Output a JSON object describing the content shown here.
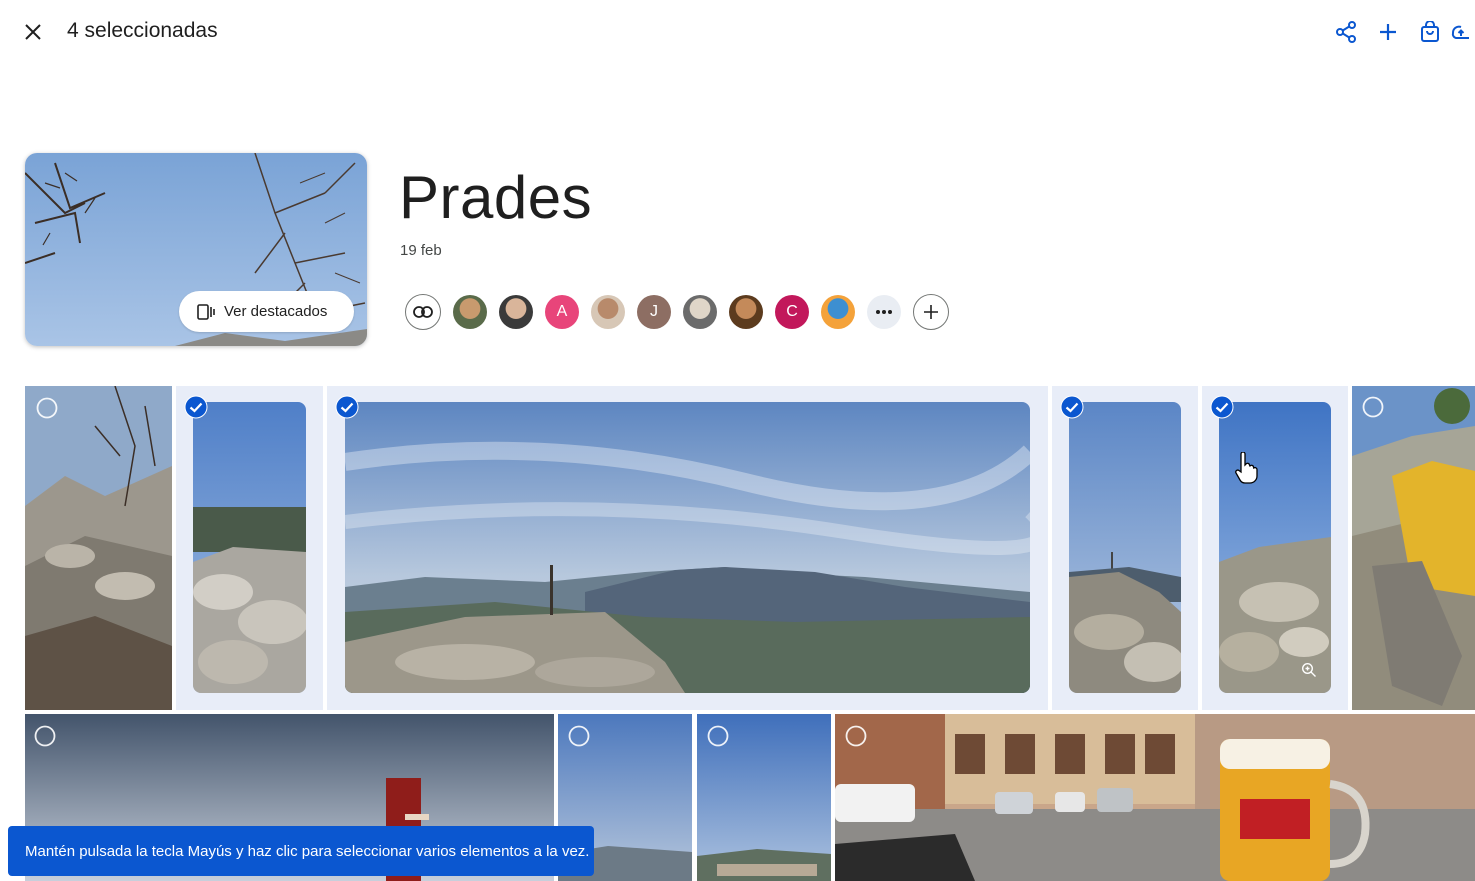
{
  "header": {
    "selection_count": "4 seleccionadas",
    "actions": [
      "share-icon",
      "add-icon",
      "bag-icon",
      "cloud-upload-icon"
    ]
  },
  "album": {
    "title": "Prades",
    "date": "19 feb",
    "highlights_label": "Ver destacados"
  },
  "people": {
    "avatars": [
      {
        "type": "photo",
        "colors": [
          "#5a6b4a",
          "#c89a6e"
        ]
      },
      {
        "type": "photo",
        "colors": [
          "#3a3a3a",
          "#d9b59a"
        ]
      },
      {
        "type": "letter",
        "letter": "A",
        "color": "#e8457a"
      },
      {
        "type": "photo",
        "colors": [
          "#d7c7b6",
          "#b88a6b"
        ]
      },
      {
        "type": "letter",
        "letter": "J",
        "color": "#8d6e63"
      },
      {
        "type": "photo",
        "colors": [
          "#6b6b6b",
          "#e0d6c8"
        ]
      },
      {
        "type": "photo",
        "colors": [
          "#5c3b1e",
          "#c48a5a"
        ]
      },
      {
        "type": "letter",
        "letter": "C",
        "color": "#c2185b"
      },
      {
        "type": "photo",
        "colors": [
          "#f4a23a",
          "#3d8fd1"
        ]
      }
    ]
  },
  "photos": {
    "selected": [
      false,
      true,
      true,
      true,
      true,
      false,
      false,
      false,
      false,
      false
    ]
  },
  "toast": {
    "message": "Mantén pulsada la tecla Mayús y haz clic para seleccionar varios elementos a la vez."
  },
  "colors": {
    "accent": "#0b57d0",
    "selected_bg": "#e8edf8"
  }
}
